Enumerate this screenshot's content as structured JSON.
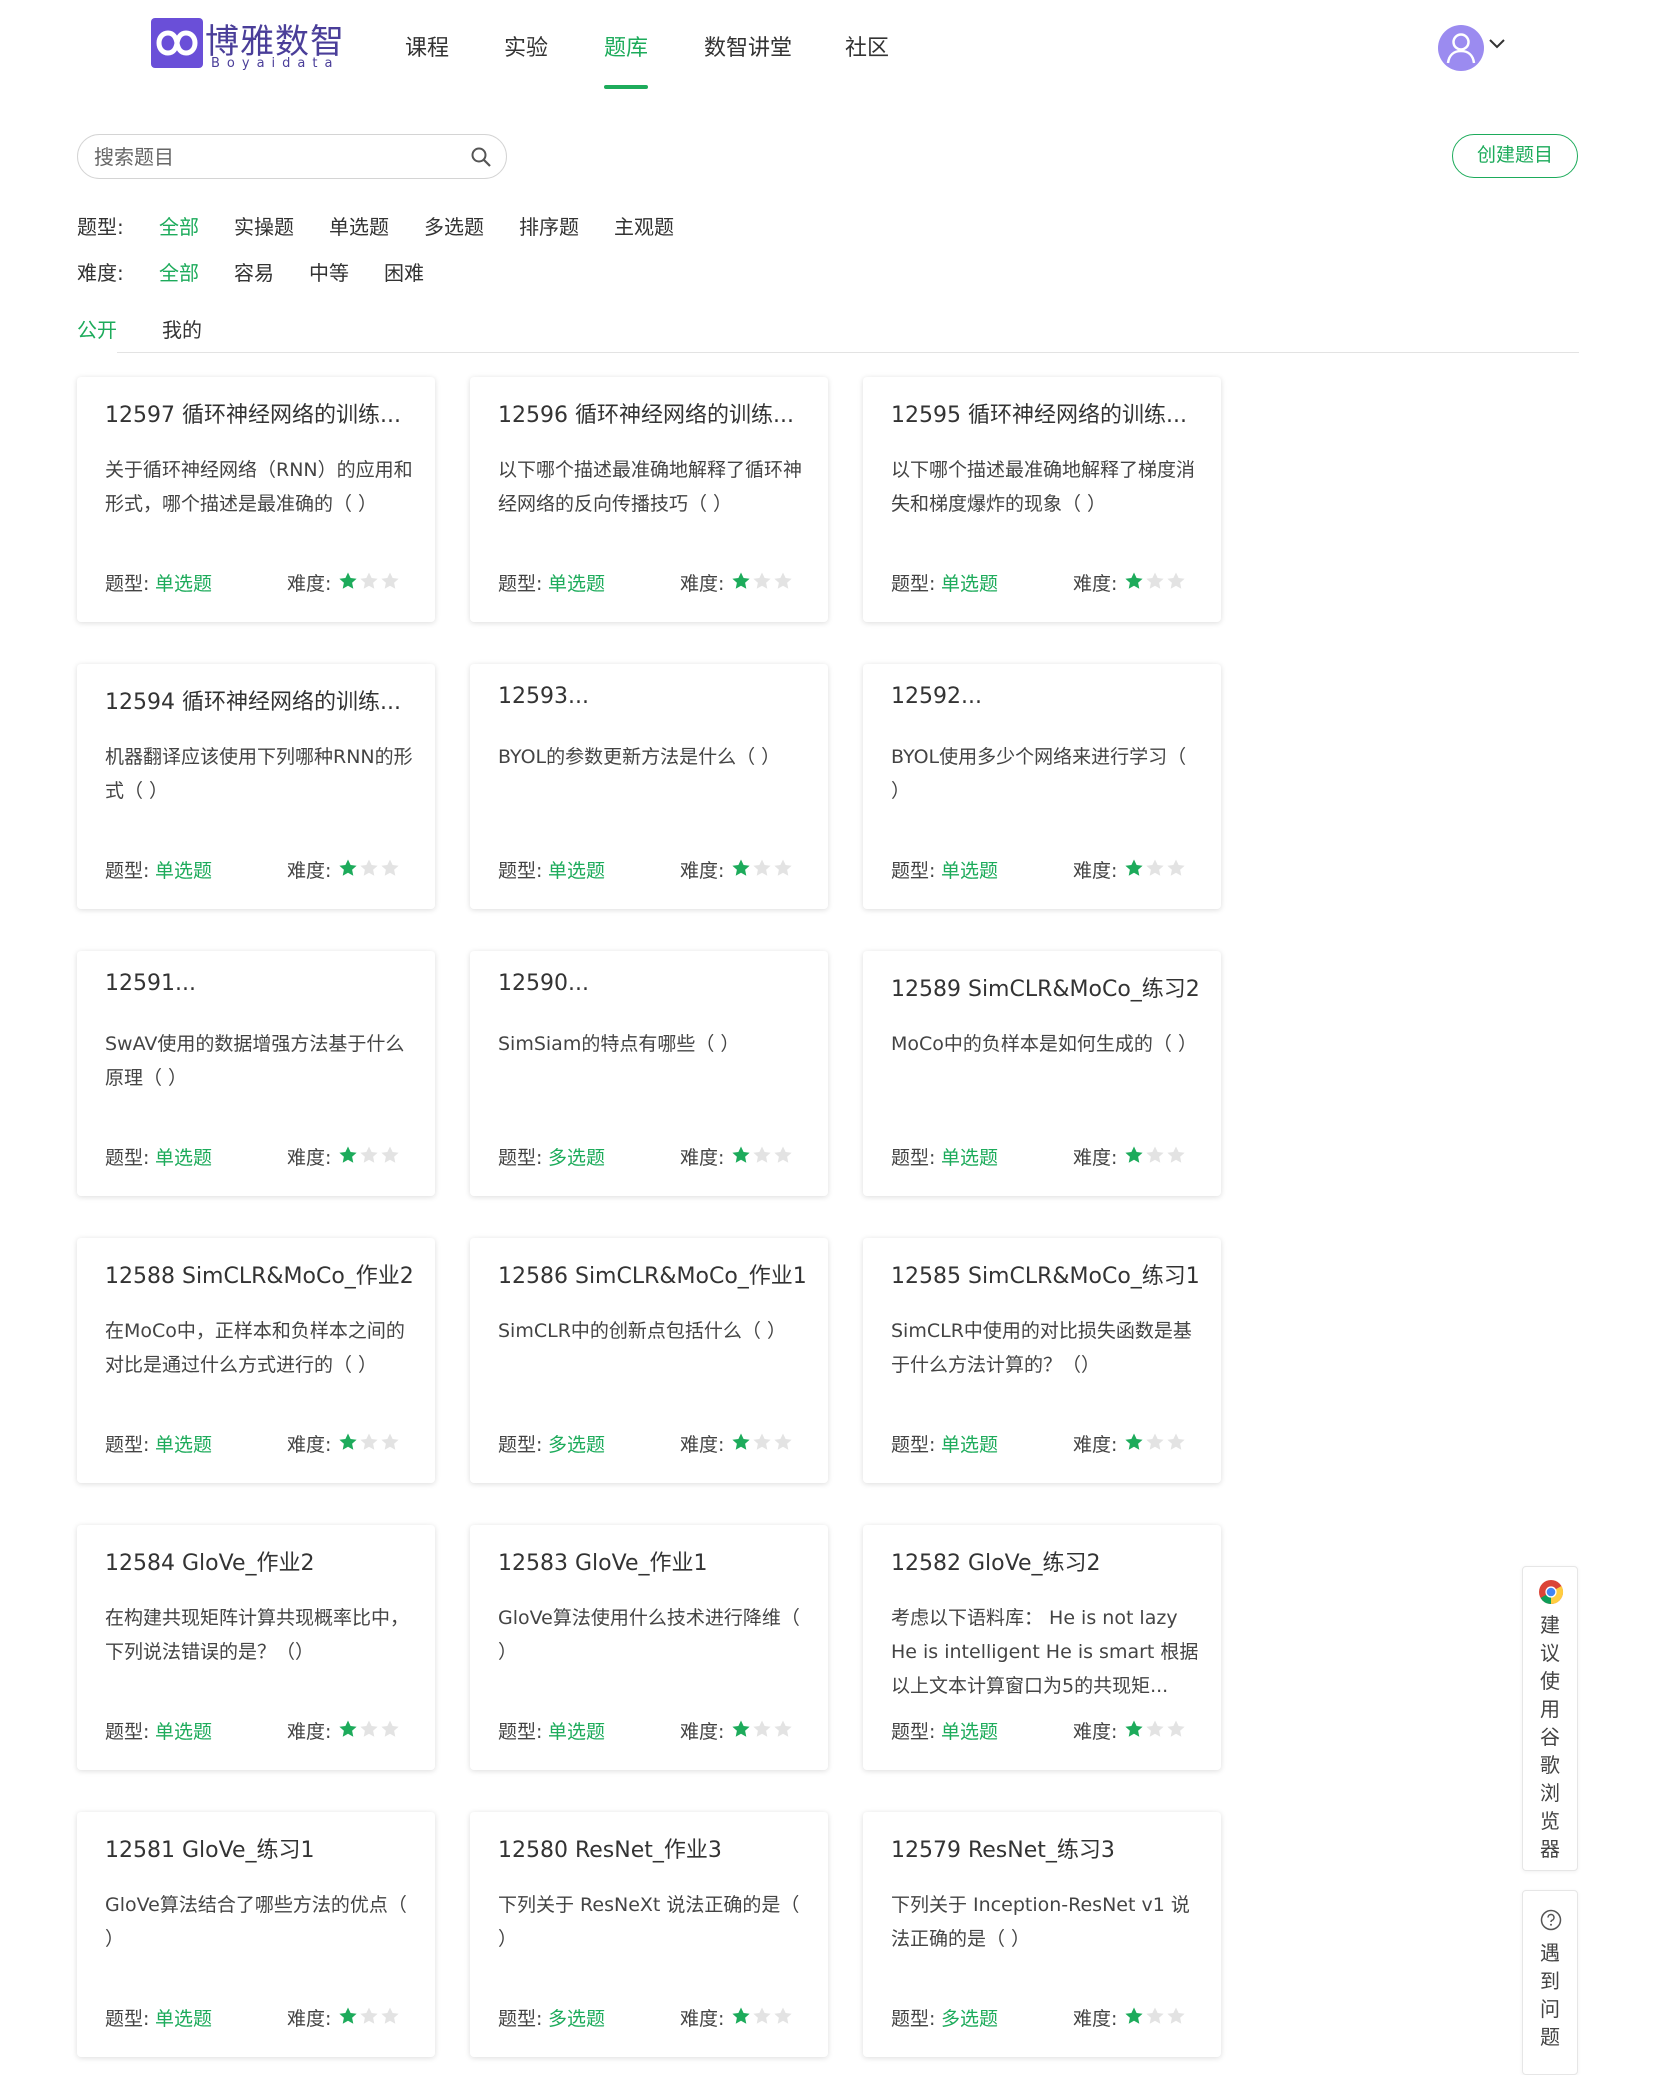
{
  "brand": {
    "name_cn": "博雅数智",
    "name_en": "Boyaidata"
  },
  "nav": {
    "items": [
      {
        "label": "课程"
      },
      {
        "label": "实验"
      },
      {
        "label": "题库"
      },
      {
        "label": "数智讲堂"
      },
      {
        "label": "社区"
      }
    ],
    "active": "题库"
  },
  "search": {
    "placeholder": "搜索题目"
  },
  "create_button": "创建题目",
  "filters": {
    "type": {
      "label": "题型:",
      "options": [
        "全部",
        "实操题",
        "单选题",
        "多选题",
        "排序题",
        "主观题"
      ],
      "selected": "全部"
    },
    "difficulty": {
      "label": "难度:",
      "options": [
        "全部",
        "容易",
        "中等",
        "困难"
      ],
      "selected": "全部"
    }
  },
  "tabs": {
    "items": [
      "公开",
      "我的"
    ],
    "active": "公开"
  },
  "card_labels": {
    "type": "题型:",
    "difficulty": "难度:"
  },
  "questions": [
    {
      "title": "12597 循环神经网络的训练...",
      "desc": "关于循环神经网络（RNN）的应用和形式，哪个描述是最准确的（ ）",
      "type": "单选题",
      "stars": 1
    },
    {
      "title": "12596 循环神经网络的训练...",
      "desc": "以下哪个描述最准确地解释了循环神经网络的反向传播技巧（ ）",
      "type": "单选题",
      "stars": 1
    },
    {
      "title": "12595 循环神经网络的训练...",
      "desc": "以下哪个描述最准确地解释了梯度消失和梯度爆炸的现象（ ）",
      "type": "单选题",
      "stars": 1
    },
    {
      "title": "12594 循环神经网络的训练...",
      "desc": "机器翻译应该使用下列哪种RNN的形式（ ）",
      "type": "单选题",
      "stars": 1
    },
    {
      "title": "12593...",
      "desc": "BYOL的参数更新方法是什么（ ）",
      "type": "单选题",
      "stars": 1
    },
    {
      "title": "12592...",
      "desc": "BYOL使用多少个网络来进行学习（ ）",
      "type": "单选题",
      "stars": 1
    },
    {
      "title": "12591...",
      "desc": "SwAV使用的数据增强方法基于什么原理（ ）",
      "type": "单选题",
      "stars": 1
    },
    {
      "title": "12590...",
      "desc": "SimSiam的特点有哪些（ ）",
      "type": "多选题",
      "stars": 1
    },
    {
      "title": "12589 SimCLR&MoCo_练习2",
      "desc": "MoCo中的负样本是如何生成的（ ）",
      "type": "单选题",
      "stars": 1
    },
    {
      "title": "12588 SimCLR&MoCo_作业2",
      "desc": "在MoCo中，正样本和负样本之间的对比是通过什么方式进行的（ ）",
      "type": "单选题",
      "stars": 1
    },
    {
      "title": "12586 SimCLR&MoCo_作业1",
      "desc": "SimCLR中的创新点包括什么（ ）",
      "type": "多选题",
      "stars": 1
    },
    {
      "title": "12585 SimCLR&MoCo_练习1",
      "desc": "SimCLR中使用的对比损失函数是基于什么方法计算的？（）",
      "type": "单选题",
      "stars": 1
    },
    {
      "title": "12584 GloVe_作业2",
      "desc": "在构建共现矩阵计算共现概率比中，下列说法错误的是？（）",
      "type": "单选题",
      "stars": 1
    },
    {
      "title": "12583 GloVe_作业1",
      "desc": "GloVe算法使用什么技术进行降维（ ）",
      "type": "单选题",
      "stars": 1
    },
    {
      "title": "12582 GloVe_练习2",
      "desc": "考虑以下语料库： He is not lazy He is intelligent He is smart 根据以上文本计算窗口为5的共现矩...",
      "type": "单选题",
      "stars": 1
    },
    {
      "title": "12581 GloVe_练习1",
      "desc": "GloVe算法结合了哪些方法的优点（ ）",
      "type": "单选题",
      "stars": 1
    },
    {
      "title": "12580 ResNet_作业3",
      "desc": "下列关于 ResNeXt 说法正确的是（ ）",
      "type": "多选题",
      "stars": 1
    },
    {
      "title": "12579 ResNet_练习3",
      "desc": "下列关于 Inception-ResNet v1 说法正确的是（ ）",
      "type": "多选题",
      "stars": 1
    }
  ],
  "side": {
    "browser_tip": "建议使用谷歌浏览器",
    "help": "遇到问题"
  },
  "colors": {
    "accent": "#1dab5b",
    "brand": "#4a3e99",
    "star_off": "#e3e3e3"
  }
}
